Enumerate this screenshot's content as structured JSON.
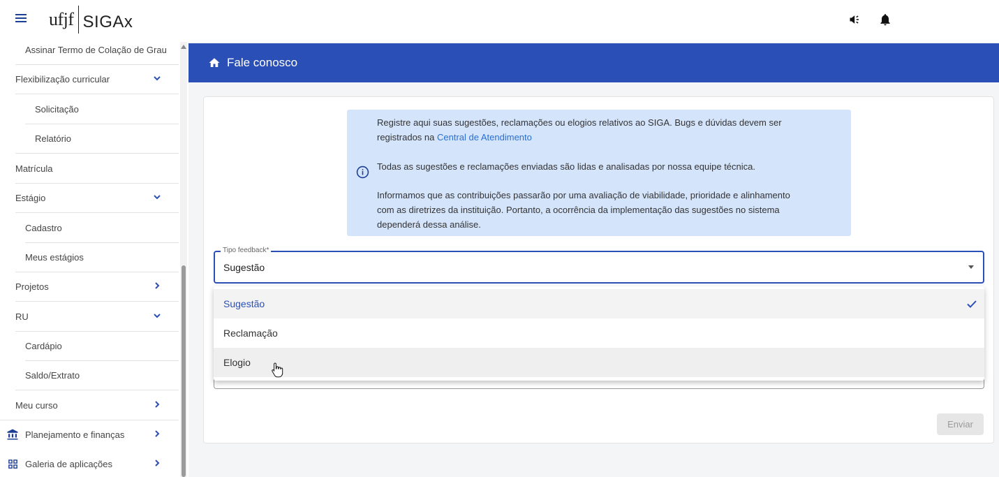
{
  "app": {
    "logo_primary": "ufjf",
    "logo_secondary": "SIGAx"
  },
  "sidebar": {
    "items": [
      {
        "label": "Assinar Termo de Colação de Grau",
        "indent": 1
      },
      {
        "label": "Flexibilização curricular",
        "indent": 0,
        "chevron": "down"
      },
      {
        "label": "Solicitação",
        "indent": 2
      },
      {
        "label": "Relatório",
        "indent": 2
      },
      {
        "label": "Matrícula",
        "indent": 0
      },
      {
        "label": "Estágio",
        "indent": 0,
        "chevron": "down"
      },
      {
        "label": "Cadastro",
        "indent": 1
      },
      {
        "label": "Meus estágios",
        "indent": 1
      },
      {
        "label": "Projetos",
        "indent": 0,
        "chevron": "right"
      },
      {
        "label": "RU",
        "indent": 0,
        "chevron": "down"
      },
      {
        "label": "Cardápio",
        "indent": 1
      },
      {
        "label": "Saldo/Extrato",
        "indent": 1
      },
      {
        "label": "Meu curso",
        "indent": 0,
        "chevron": "right"
      },
      {
        "label": "Planejamento e finanças",
        "indent": 1,
        "chevron": "right",
        "icon": "bank-icon"
      },
      {
        "label": "Galeria de aplicações",
        "indent": 1,
        "chevron": "right",
        "icon": "grid-icon"
      }
    ]
  },
  "header": {
    "title": "Fale conosco"
  },
  "info": {
    "line1": "Registre aqui suas sugestões, reclamações ou elogios relativos ao SIGA. Bugs e dúvidas devem ser",
    "line2_prefix": "registrados na ",
    "line2_link": "Central de Atendimento",
    "line3": "Todas as sugestões e reclamações enviadas são lidas e analisadas por nossa equipe técnica.",
    "line4": "Informamos que as contribuições passarão por uma avaliação de viabilidade, prioridade e alinhamento",
    "line5": "com as diretrizes da instituição. Portanto, a ocorrência da implementação das sugestões no sistema",
    "line6": "dependerá dessa análise."
  },
  "form": {
    "select_label": "Tipo feedback*",
    "select_value": "Sugestão",
    "options": [
      "Sugestão",
      "Reclamação",
      "Elogio"
    ],
    "send_label": "Enviar"
  },
  "colors": {
    "primary": "#2a4fb6",
    "info_bg": "#d4e4fb",
    "link": "#2a6fd1"
  }
}
